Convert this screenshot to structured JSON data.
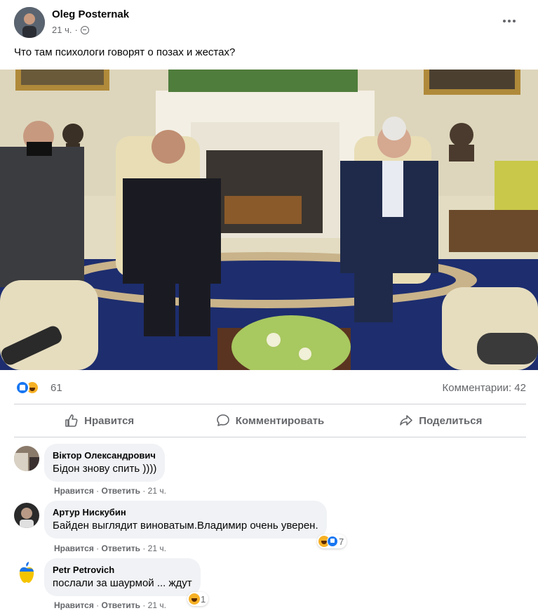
{
  "post": {
    "author": "Oleg Posternak",
    "time": "21 ч.",
    "audience_icon": "globe-icon",
    "text": "Что там психологи говорят о позах и жестах?",
    "photo_icon": "photo"
  },
  "stats": {
    "reactions": [
      "like",
      "haha"
    ],
    "reaction_count": "61",
    "comments_label": "Комментарии: 42"
  },
  "actions": {
    "like": "Нравится",
    "comment": "Комментировать",
    "share": "Поделиться"
  },
  "comments": [
    {
      "name": "Віктор Олександрович",
      "text": "Бідон знову спить ))))",
      "like": "Нравится",
      "reply": "Ответить",
      "time": "21 ч.",
      "reaction_count": ""
    },
    {
      "name": "Артур Нискубин",
      "text": "Байден выглядит виноватым.Владимир очень уверен.",
      "like": "Нравится",
      "reply": "Ответить",
      "time": "21 ч.",
      "reaction_count": "7"
    },
    {
      "name": "Petr Petrovich",
      "text": "послали за шаурмой ... ждут",
      "like": "Нравится",
      "reply": "Ответить",
      "time": "21 ч.",
      "reaction_count": "1"
    }
  ],
  "separator": "·",
  "colors": {
    "primary_text": "#050505",
    "secondary_text": "#65676b",
    "bubble": "#f0f2f5",
    "like_blue": "#1877f2",
    "haha_yellow": "#f7b125"
  }
}
